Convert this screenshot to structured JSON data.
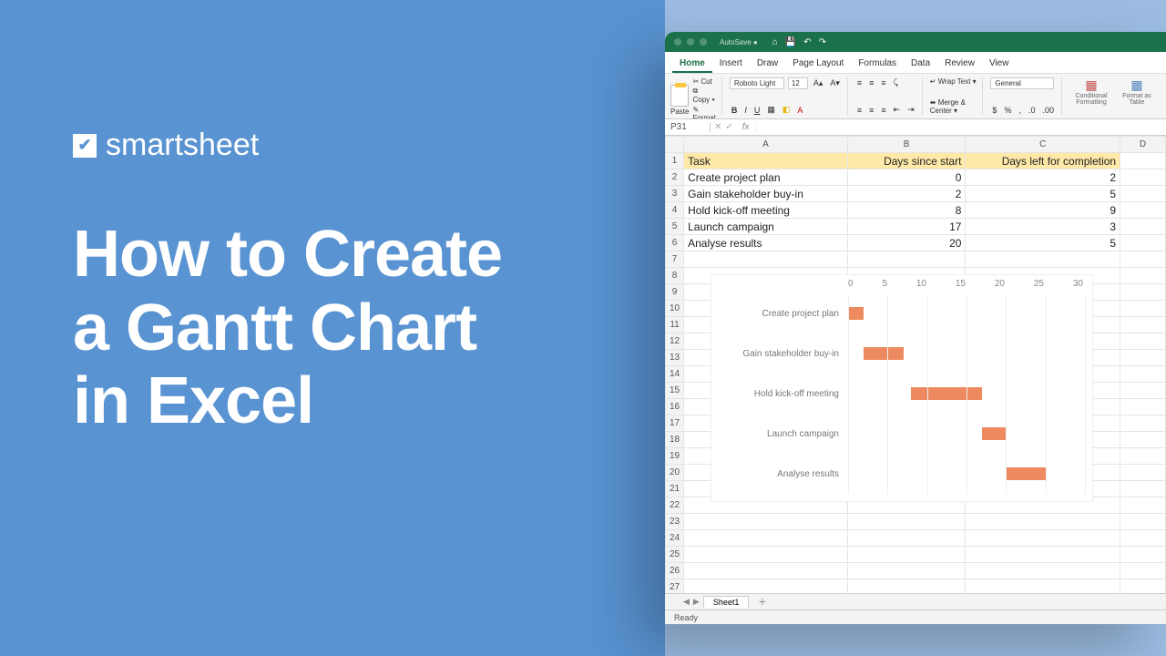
{
  "brand": "smartsheet",
  "title_lines": [
    "How to Create",
    "a Gantt Chart",
    "in Excel"
  ],
  "titlebar": {
    "autosave": "AutoSave ●"
  },
  "ribbon_tabs": [
    "Home",
    "Insert",
    "Draw",
    "Page Layout",
    "Formulas",
    "Data",
    "Review",
    "View"
  ],
  "ribbon": {
    "paste": "Paste",
    "cut": "Cut",
    "copy": "Copy ▾",
    "format": "Format",
    "font": "Roboto Light",
    "size": "12",
    "wrap": "Wrap Text ▾",
    "merge": "Merge & Center ▾",
    "numfmt": "General",
    "cond": "Conditional Formatting",
    "table": "Format as Table"
  },
  "formula": {
    "name": "P31",
    "fx": "fx"
  },
  "columns": [
    "A",
    "B",
    "C",
    "D"
  ],
  "headers": {
    "A": "Task",
    "B": "Days since start",
    "C": "Days left for completion"
  },
  "rows": [
    {
      "task": "Create project plan",
      "start": "0",
      "left": "2"
    },
    {
      "task": "Gain stakeholder buy-in",
      "start": "2",
      "left": "5"
    },
    {
      "task": "Hold kick-off meeting",
      "start": "8",
      "left": "9"
    },
    {
      "task": "Launch campaign",
      "start": "17",
      "left": "3"
    },
    {
      "task": "Analyse results",
      "start": "20",
      "left": "5"
    }
  ],
  "sheet_name": "Sheet1",
  "status": "Ready",
  "chart_data": {
    "type": "bar",
    "title": "",
    "xlabel": "",
    "ylabel": "",
    "xlim": [
      0,
      30
    ],
    "ticks": [
      0,
      5,
      10,
      15,
      20,
      25,
      30
    ],
    "categories": [
      "Create project plan",
      "Gain stakeholder buy-in",
      "Hold kick-off meeting",
      "Launch campaign",
      "Analyse results"
    ],
    "series": [
      {
        "name": "Days since start",
        "values": [
          0,
          2,
          8,
          17,
          20
        ]
      },
      {
        "name": "Days left for completion",
        "values": [
          2,
          5,
          9,
          3,
          5
        ]
      }
    ]
  }
}
